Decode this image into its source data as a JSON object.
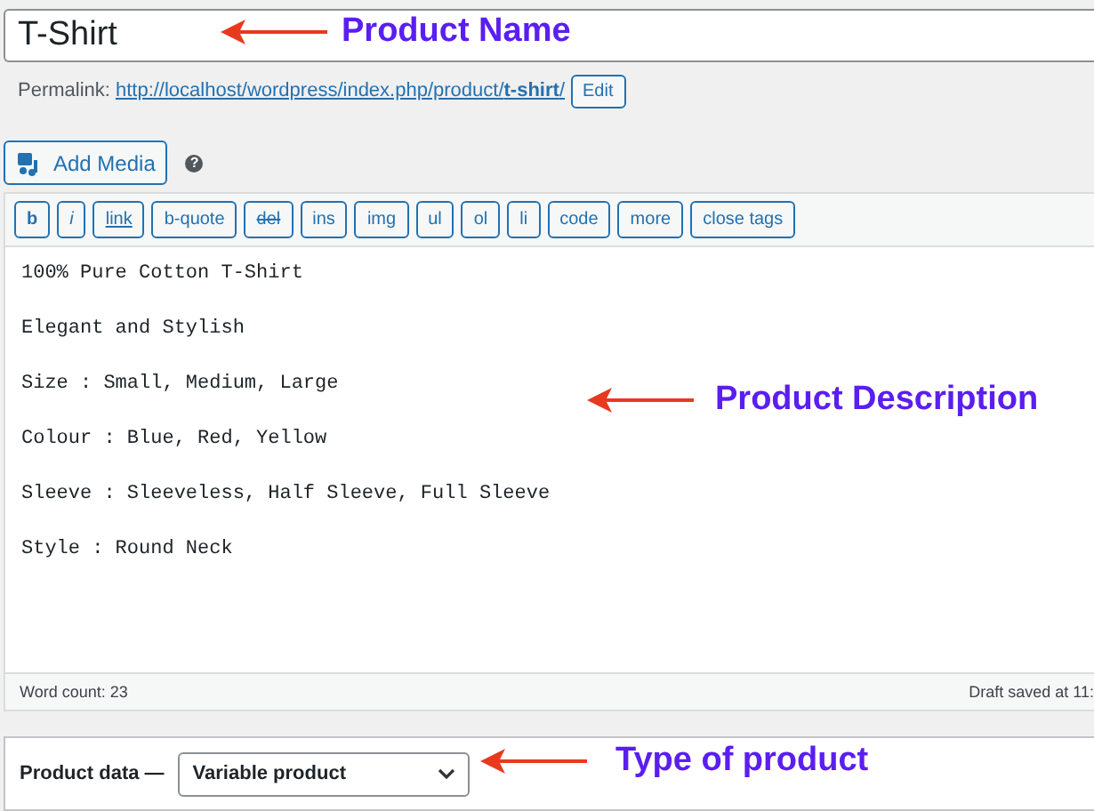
{
  "title_field": {
    "value": "T-Shirt"
  },
  "permalink": {
    "label": "Permalink:",
    "url": "http://localhost/wordpress/index.php/product/**t-shirt**/",
    "edit_button": "Edit"
  },
  "add_media": {
    "label": "Add Media",
    "help": "?"
  },
  "toolbar": [
    {
      "label": "b",
      "kind": "bold"
    },
    {
      "label": "i",
      "kind": "italic"
    },
    {
      "label": "link",
      "kind": "underline"
    },
    {
      "label": "b-quote",
      "kind": "plain"
    },
    {
      "label": "del",
      "kind": "strike"
    },
    {
      "label": "ins",
      "kind": "plain"
    },
    {
      "label": "img",
      "kind": "plain"
    },
    {
      "label": "ul",
      "kind": "plain"
    },
    {
      "label": "ol",
      "kind": "plain"
    },
    {
      "label": "li",
      "kind": "plain"
    },
    {
      "label": "code",
      "kind": "plain"
    },
    {
      "label": "more",
      "kind": "plain"
    },
    {
      "label": "close tags",
      "kind": "plain"
    }
  ],
  "description": [
    "100% Pure Cotton T-Shirt",
    "Elegant and Stylish",
    "Size : Small, Medium, Large",
    "Colour : Blue, Red, Yellow",
    "Sleeve : Sleeveless, Half Sleeve, Full Sleeve",
    "Style : Round Neck"
  ],
  "status_bar": {
    "word_count": "Word count: 23",
    "draft_saved": "Draft saved at 11:"
  },
  "product_data": {
    "label": "Product data —",
    "type_select": "Variable product"
  },
  "annotations": [
    {
      "text": "Product Name",
      "kind": "title"
    },
    {
      "text": "Product Description",
      "kind": "description"
    },
    {
      "text": "Type of product",
      "kind": "type"
    }
  ]
}
